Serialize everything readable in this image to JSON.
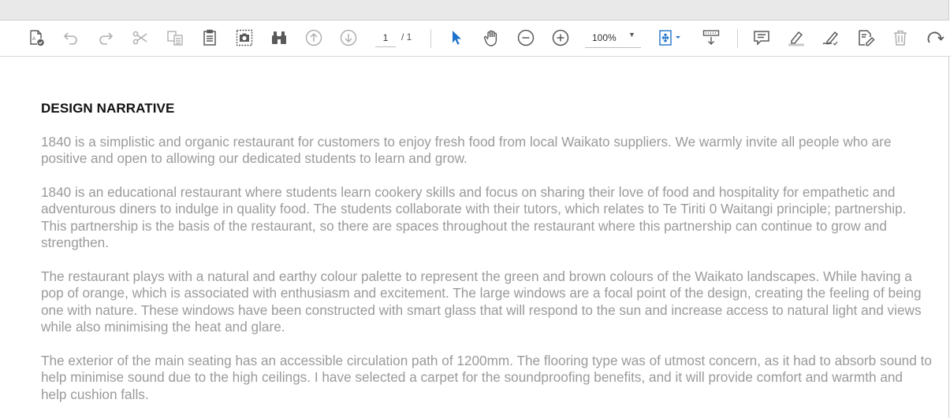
{
  "toolbar": {
    "page_current": "1",
    "page_total": "/ 1",
    "zoom": "100%",
    "icons": {
      "accent": "#1f73c9",
      "icon_color": "#5a5a5a",
      "disabled_color": "#b0b0b0"
    }
  },
  "document": {
    "heading": "DESIGN NARRATIVE",
    "paragraphs": [
      "1840 is a simplistic and organic restaurant for customers to enjoy fresh food from local Waikato suppliers. We warmly invite all people who are positive and open to allowing our dedicated students to learn and grow.",
      "1840 is an educational restaurant where students learn cookery skills and focus on sharing their love of food and hospitality for empathetic and adventurous diners to indulge in quality food. The students collaborate with their tutors, which relates to Te Tiriti 0 Waitangi principle; partnership. This partnership is the basis of the restaurant, so there are spaces throughout the restaurant where this partnership can continue to grow and strengthen.",
      "The restaurant plays with a natural and earthy colour palette to represent the green and brown colours of the Waikato landscapes. While having a pop of orange, which is associated with enthusiasm and excitement. The large windows are a focal point of the design, creating the feeling of being one with nature. These windows have been constructed with smart glass that will respond to the sun and increase access to natural light and views while also minimising the heat and glare.",
      "The exterior of the main seating has an accessible circulation path of 1200mm. The flooring type was of utmost concern, as it had to absorb sound to help minimise sound due to the high ceilings. I have selected a carpet for the soundproofing benefits, and it will provide comfort and warmth and help cushion falls."
    ]
  }
}
